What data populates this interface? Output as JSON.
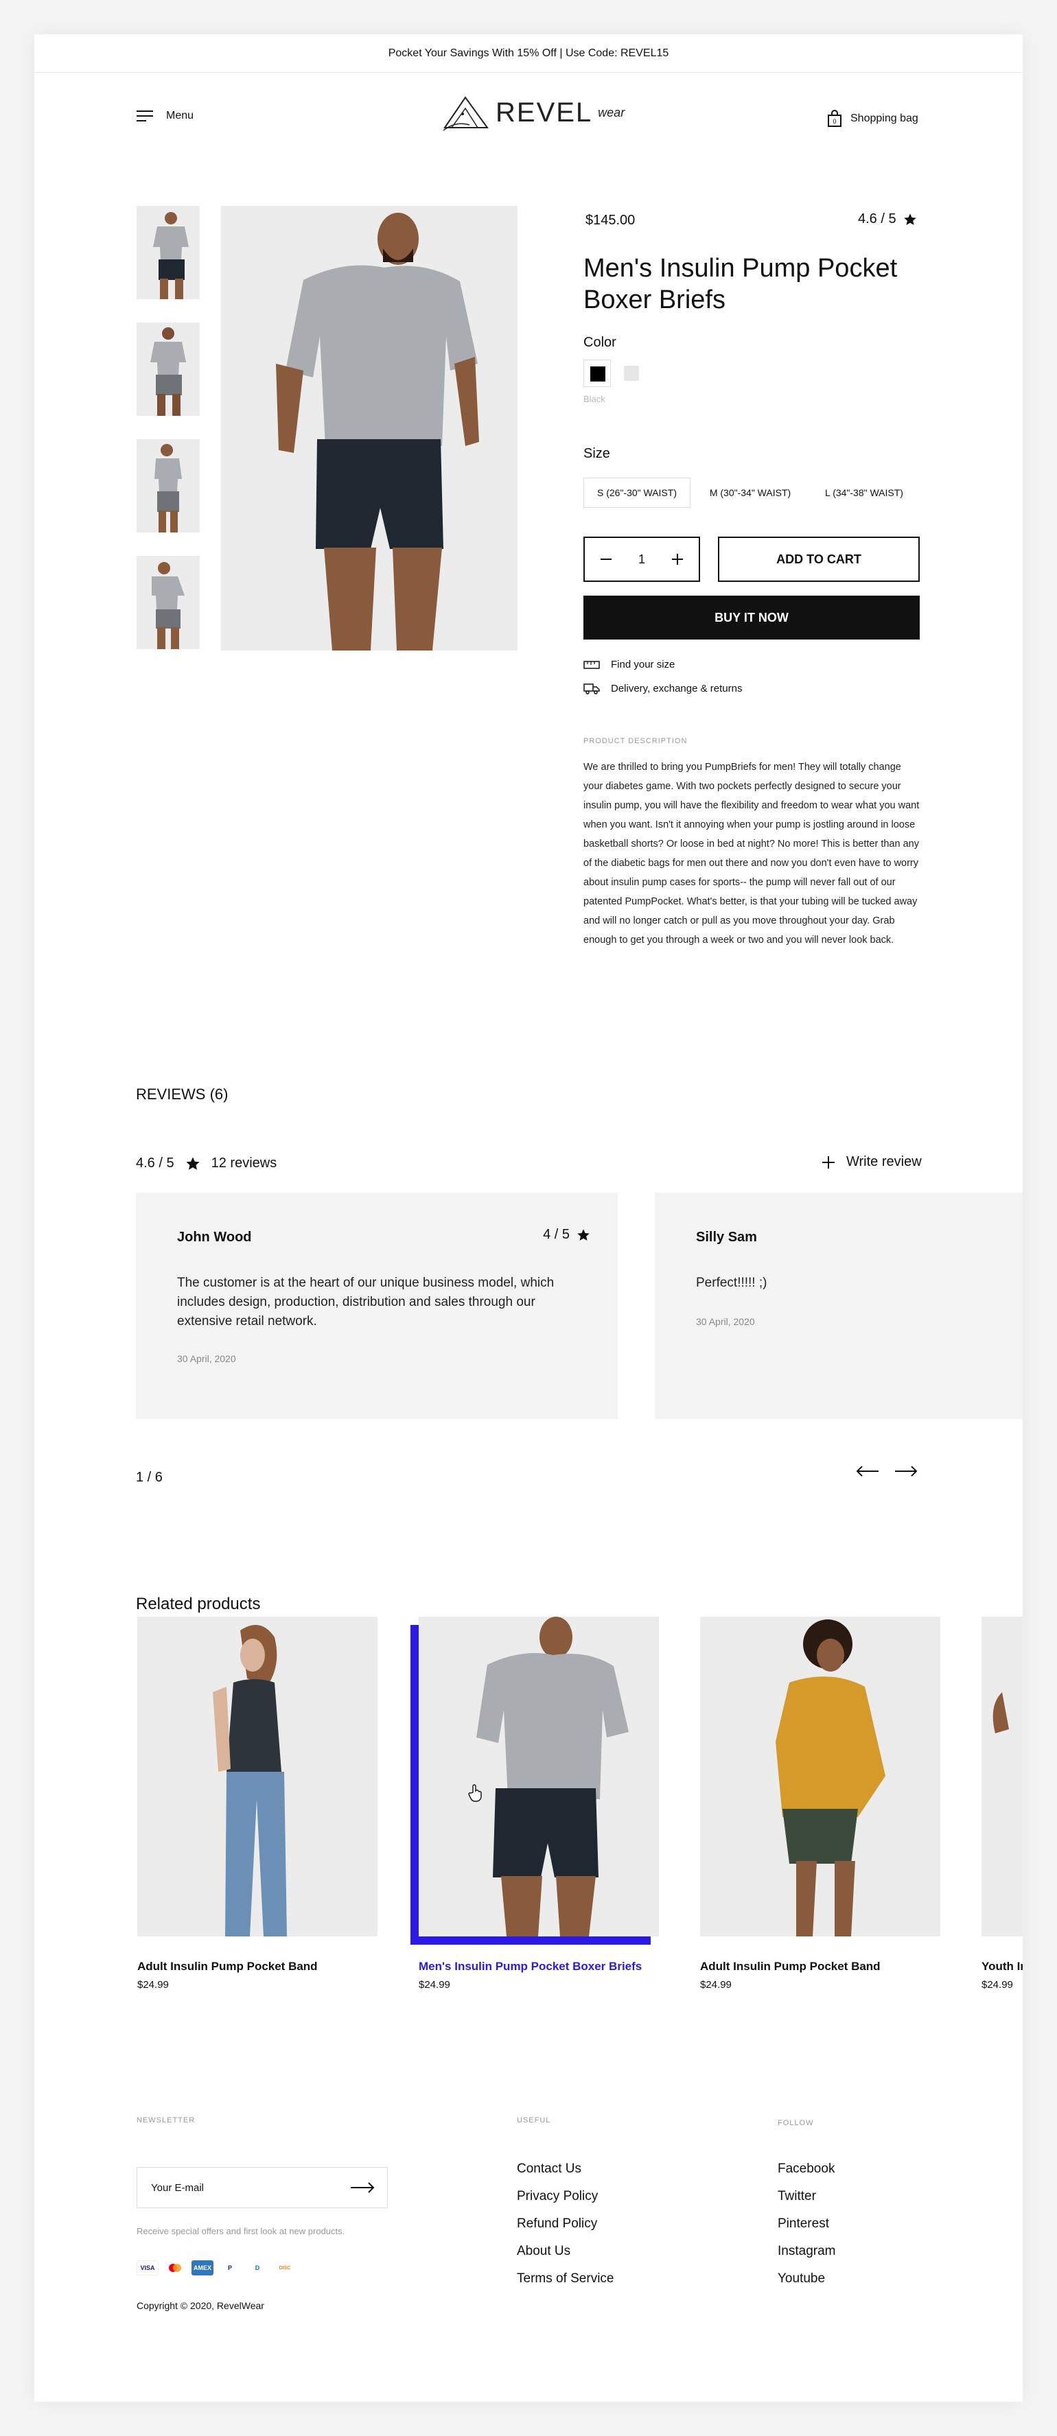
{
  "promo_text": "Pocket Your Savings With 15% Off | Use Code: REVEL15",
  "header": {
    "menu_label": "Menu",
    "logo_name": "REVEL",
    "logo_sub": "wear",
    "bag_label": "Shopping bag",
    "bag_count": "0"
  },
  "product": {
    "price": "$145.00",
    "rating": "4.6 / 5",
    "title": "Men's Insulin Pump Pocket Boxer Briefs",
    "color_label": "Color",
    "selected_color": "Black",
    "colors": [
      "#000000",
      "#e6e6e6"
    ],
    "size_label": "Size",
    "sizes": [
      "S (26\"-30\" WAIST)",
      "M (30\"-34\" WAIST)",
      "L (34\"-38\" WAIST)"
    ],
    "selected_size": 0,
    "quantity": "1",
    "add_to_cart": "ADD TO CART",
    "buy_now": "BUY IT NOW",
    "find_size": "Find your size",
    "delivery": "Delivery, exchange & returns",
    "description_heading": "PRODUCT DESCRIPTION",
    "description": "We are thrilled to bring you PumpBriefs for men! They will totally change your diabetes game. With two pockets perfectly designed to secure your insulin pump, you will have the flexibility and freedom to wear what you want when you want. Isn't it annoying when your pump is jostling around in loose basketball shorts? Or loose in bed at night? No more! This is better than any of the diabetic bags for men out there and now you don't even have to worry about insulin pump cases for sports-- the pump will never fall out of our patented PumpPocket. What's better, is that your tubing will be tucked away and will no longer catch or pull as you move throughout your day. Grab enough to get you through a week or two and you will never look back."
  },
  "reviews": {
    "title": "REVIEWS (6)",
    "summary_rating": "4.6 / 5",
    "summary_count": "12 reviews",
    "write_label": "Write review",
    "items": [
      {
        "name": "John Wood",
        "rating": "4 / 5",
        "text": "The customer is at the heart of our unique business model, which includes design, production, distribution and sales through our extensive retail network.",
        "date": "30 April, 2020"
      },
      {
        "name": "Silly Sam",
        "rating": "",
        "text": "Perfect!!!!! ;)",
        "date": "30 April, 2020"
      }
    ],
    "pager": "1 / 6"
  },
  "related": {
    "title": "Related products",
    "items": [
      {
        "name": "Adult Insulin Pump Pocket Band",
        "price": "$24.99"
      },
      {
        "name": "Men's Insulin Pump Pocket Boxer Briefs",
        "price": "$24.99"
      },
      {
        "name": "Adult Insulin Pump Pocket Band",
        "price": "$24.99"
      },
      {
        "name": "Youth In",
        "price": "$24.99"
      }
    ],
    "highlight_color": "#2c19e6"
  },
  "footer": {
    "newsletter_heading": "NEWSLETTER",
    "email_placeholder": "Your E-mail",
    "newsletter_note": "Receive special offers and first look at new products.",
    "payments": [
      "VISA",
      "MC",
      "AMEX",
      "P",
      "D",
      "DISC"
    ],
    "copyright": "Copyright © 2020, RevelWear",
    "useful_heading": "USEFUL",
    "useful_links": [
      "Contact Us",
      "Privacy Policy",
      "Refund Policy",
      "About Us",
      "Terms of Service"
    ],
    "follow_heading": "FOLLOW",
    "follow_links": [
      "Facebook",
      "Twitter",
      "Pinterest",
      "Instagram",
      "Youtube"
    ]
  }
}
